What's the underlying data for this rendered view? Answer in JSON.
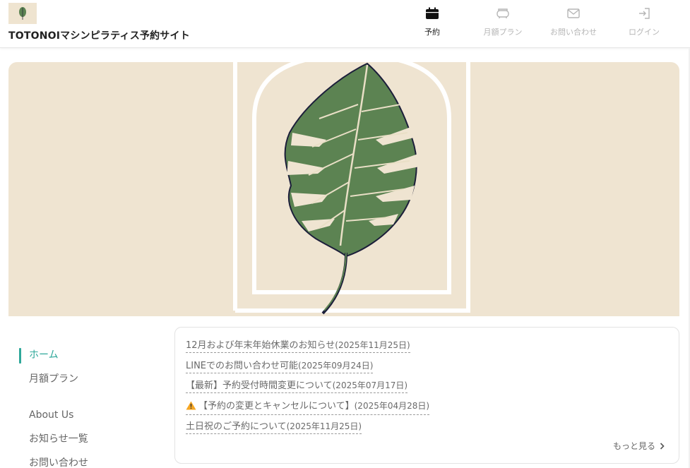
{
  "header": {
    "site_title": "TOTONOIマシンピラティス予約サイト",
    "logo_text": "TOTONOI"
  },
  "nav": {
    "items": [
      {
        "label": "予約",
        "icon": "calendar-icon",
        "active": true
      },
      {
        "label": "月額プラン",
        "icon": "plan-icon",
        "active": false
      },
      {
        "label": "お問い合わせ",
        "icon": "mail-icon",
        "active": false
      },
      {
        "label": "ログイン",
        "icon": "login-icon",
        "active": false
      }
    ]
  },
  "sidebar": {
    "items": [
      {
        "label": "ホーム",
        "active": true
      },
      {
        "label": "月額プラン"
      },
      {
        "label": "About Us"
      },
      {
        "label": "お知らせ一覧"
      },
      {
        "label": "お問い合わせ"
      }
    ]
  },
  "news": {
    "items": [
      {
        "title": "12月および年末年始休業のお知らせ",
        "date": "(2025年11月25日)"
      },
      {
        "title": "LINEでのお問い合わせ可能",
        "date": "(2025年09月24日)"
      },
      {
        "title": "【最新】予約受付時間変更について",
        "date": "(2025年07月17日)"
      },
      {
        "title": "【予約の変更とキャンセルについて】",
        "date": "(2025年04月28日)",
        "icon": "warning-icon"
      },
      {
        "title": "土日祝のご予約について",
        "date": "(2025年11月25日)"
      }
    ],
    "more_label": "もっと見る"
  },
  "colors": {
    "accent": "#2fa89a",
    "hero_bg": "#efe4d1",
    "leaf": "#5c8352"
  }
}
